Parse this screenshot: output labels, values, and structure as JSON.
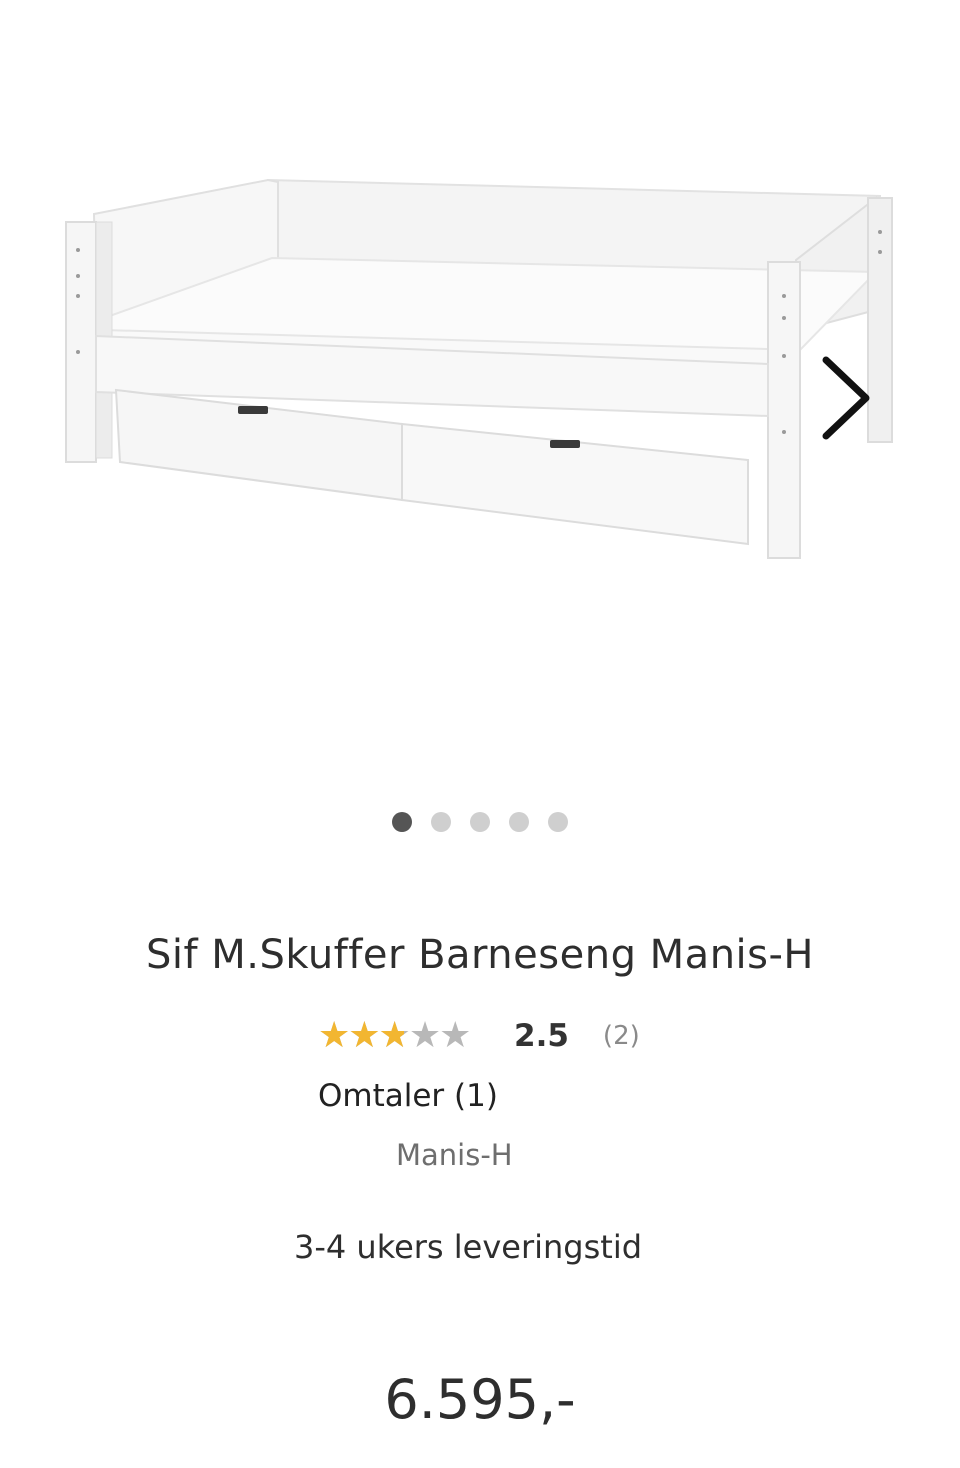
{
  "gallery": {
    "image_alt": "Sif M.Skuffer Barneseng Manis-H",
    "next_icon": "chevron-right-icon",
    "slides_total": 5,
    "active_slide": 1
  },
  "product": {
    "title": "Sif M.Skuffer Barneseng Manis-H",
    "rating": {
      "stars_icon": "star-rating-icon",
      "value": "2.5",
      "fraction": 0.5,
      "count": "(2)"
    },
    "reviews_link": "Omtaler (1)",
    "brand": "Manis-H",
    "delivery": "3-4 ukers leveringstid",
    "price": "6.595,-"
  },
  "colors": {
    "star_fill": "#f2b631",
    "star_empty": "#b8b8b8",
    "dot_active": "#555555",
    "dot_inactive": "#cfcfcf"
  }
}
